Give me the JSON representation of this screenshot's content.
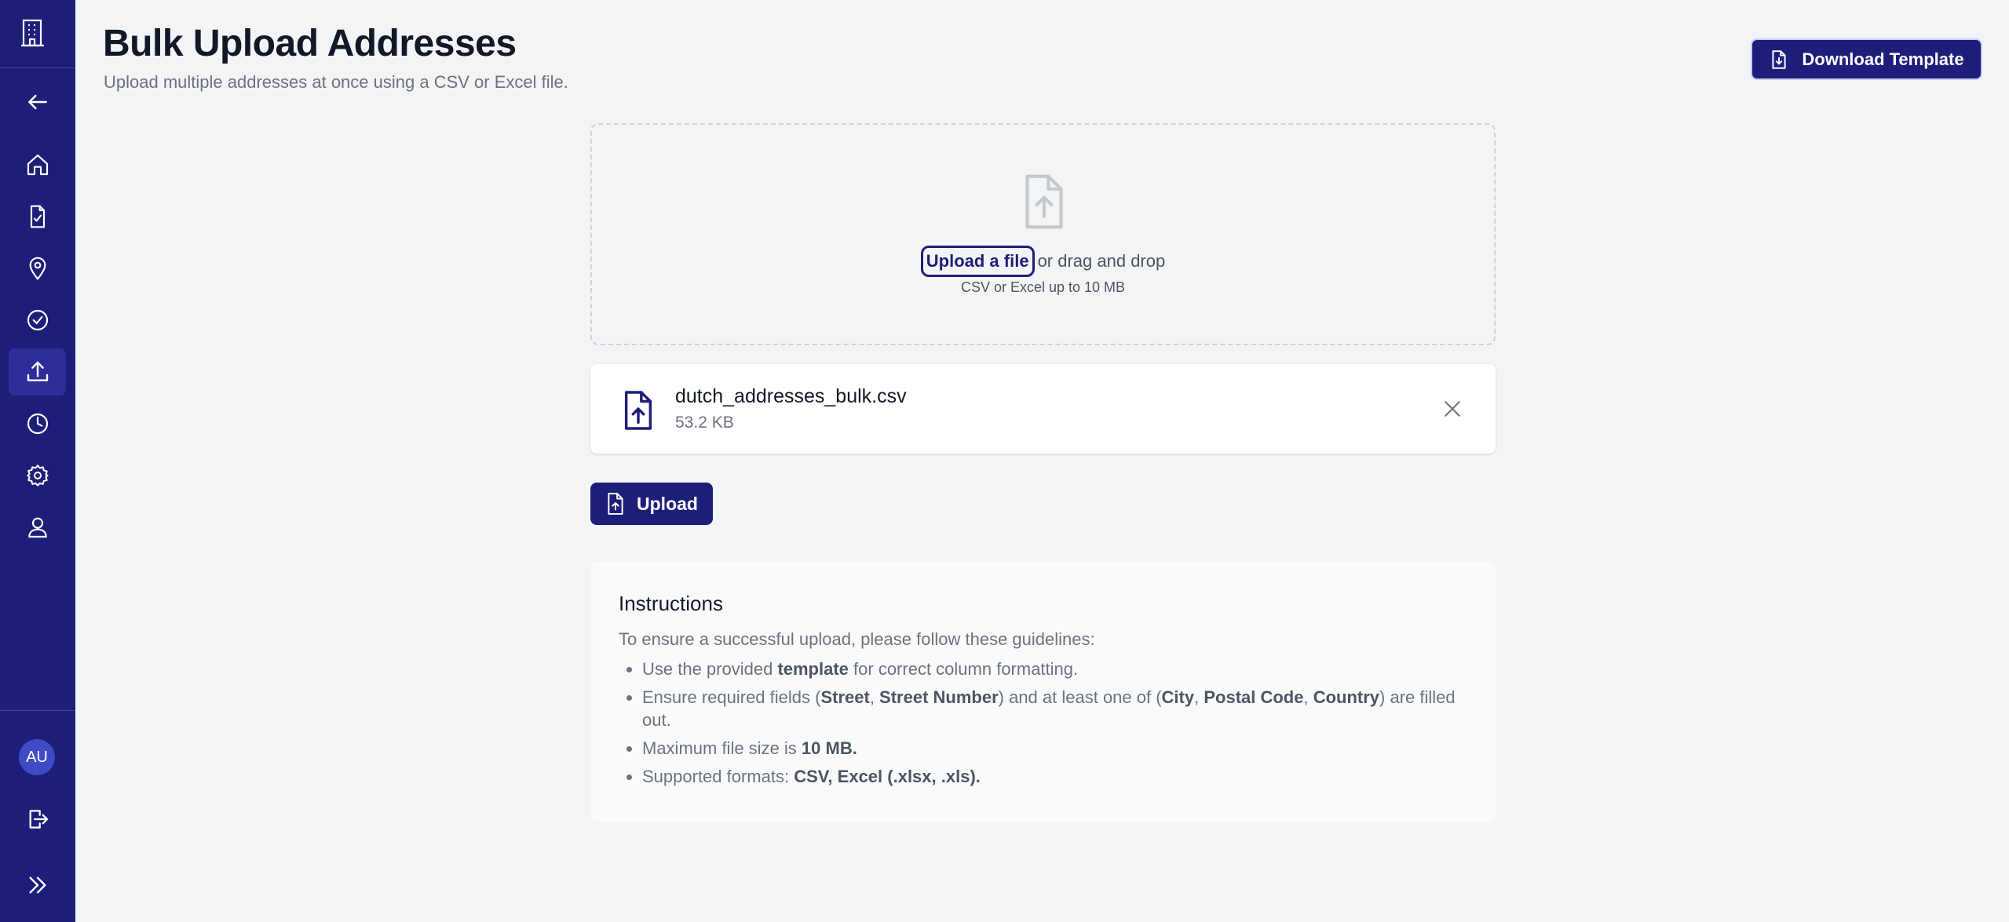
{
  "header": {
    "title": "Bulk Upload Addresses",
    "subtitle": "Upload multiple addresses at once using a CSV or Excel file.",
    "download_label": "Download Template"
  },
  "sidebar": {
    "logo_icon": "building-icon",
    "avatar_initials": "AU",
    "accent_color": "#1e1e7a",
    "items": [
      {
        "icon": "arrow-left-icon",
        "active": false
      },
      {
        "icon": "home-icon",
        "active": false
      },
      {
        "icon": "file-check-icon",
        "active": false
      },
      {
        "icon": "map-pin-icon",
        "active": false
      },
      {
        "icon": "check-circle-icon",
        "active": false
      },
      {
        "icon": "upload-icon",
        "active": true
      },
      {
        "icon": "clock-icon",
        "active": false
      },
      {
        "icon": "gear-icon",
        "active": false
      },
      {
        "icon": "user-icon",
        "active": false
      },
      {
        "icon": "logout-icon",
        "active": false
      },
      {
        "icon": "chevrons-right-icon",
        "active": false
      }
    ]
  },
  "dropzone": {
    "link_label": "Upload a file",
    "drag_text": "or drag and drop",
    "hint": "CSV or Excel up to 10 MB"
  },
  "file": {
    "name": "dutch_addresses_bulk.csv",
    "size": "53.2 KB"
  },
  "upload_button": {
    "label": "Upload"
  },
  "instructions": {
    "title": "Instructions",
    "intro": "To ensure a successful upload, please follow these guidelines:",
    "items": [
      {
        "parts": [
          {
            "t": "Use the provided "
          },
          {
            "t": "template",
            "b": true
          },
          {
            "t": " for correct column formatting."
          }
        ]
      },
      {
        "parts": [
          {
            "t": "Ensure required fields ("
          },
          {
            "t": "Street",
            "b": true
          },
          {
            "t": ", "
          },
          {
            "t": "Street Number",
            "b": true
          },
          {
            "t": ") and at least one of ("
          },
          {
            "t": "City",
            "b": true
          },
          {
            "t": ", "
          },
          {
            "t": "Postal Code",
            "b": true
          },
          {
            "t": ", "
          },
          {
            "t": "Country",
            "b": true
          },
          {
            "t": ") are filled out."
          }
        ]
      },
      {
        "parts": [
          {
            "t": "Maximum file size is "
          },
          {
            "t": "10 MB.",
            "b": true
          }
        ]
      },
      {
        "parts": [
          {
            "t": "Supported formats: "
          },
          {
            "t": "CSV, Excel (.xlsx, .xls).",
            "b": true
          }
        ]
      }
    ]
  }
}
